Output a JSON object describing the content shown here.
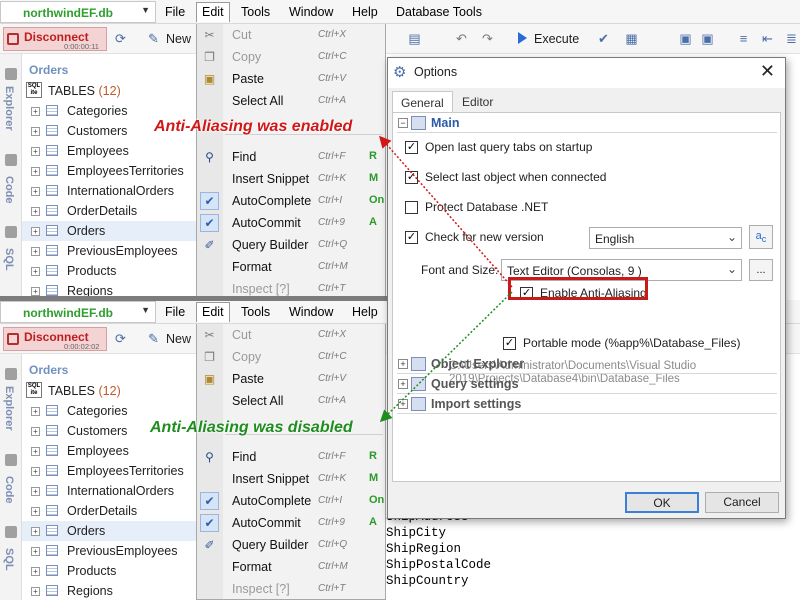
{
  "db_name": "northwindEF.db",
  "menu": [
    "File",
    "Edit",
    "Tools",
    "Window",
    "Help",
    "Database Tools"
  ],
  "toolbar": {
    "disconnect": "Disconnect",
    "time_top": "0:00:00:11",
    "time_bottom": "0:00:02:02",
    "new": "New",
    "execute": "Execute"
  },
  "rail": {
    "explorer": "Explorer",
    "code": "Code",
    "sql": "SQL"
  },
  "explorer": {
    "title": "Orders",
    "tables_label": "TABLES",
    "tables_count": "(12)",
    "items": [
      "Categories",
      "Customers",
      "Employees",
      "EmployeesTerritories",
      "InternationalOrders",
      "OrderDetails",
      "Orders",
      "PreviousEmployees",
      "Products",
      "Regions"
    ]
  },
  "edit_menu": [
    {
      "label": "Cut",
      "shortcut": "Ctrl+X",
      "disabled": true
    },
    {
      "label": "Copy",
      "shortcut": "Ctrl+C",
      "disabled": true
    },
    {
      "label": "Paste",
      "shortcut": "Ctrl+V"
    },
    {
      "label": "Select All",
      "shortcut": "Ctrl+A"
    },
    {
      "label": "Find",
      "shortcut": "Ctrl+F",
      "badge": "R"
    },
    {
      "label": "Insert Snippet",
      "shortcut": "Ctrl+K",
      "badge": "M"
    },
    {
      "label": "AutoComplete",
      "shortcut": "Ctrl+I",
      "badge": "On",
      "checked": true
    },
    {
      "label": "AutoCommit",
      "shortcut": "Ctrl+9",
      "badge": "A",
      "checked": true
    },
    {
      "label": "Query Builder",
      "shortcut": "Ctrl+Q"
    },
    {
      "label": "Format",
      "shortcut": "Ctrl+M"
    },
    {
      "label": "Inspect [?]",
      "shortcut": "Ctrl+T",
      "disabled": true
    }
  ],
  "code_lines": [
    "ShipAddress",
    "ShipCity",
    "ShipRegion",
    "ShipPostalCode",
    "ShipCountry"
  ],
  "dialog": {
    "title": "Options",
    "tabs": [
      "General",
      "Editor"
    ],
    "section_main": "Main",
    "opt_open_last": "Open last query tabs on startup",
    "opt_select_last": "Select last object when connected",
    "opt_protect": "Protect Database .NET",
    "opt_check_version": "Check for new version",
    "language": "English",
    "font_size_label": "Font and Size:",
    "font_value": "Text Editor (Consolas, 9 )",
    "opt_anti_alias": "Enable Anti-Aliasing",
    "path_line1": "C:\\Users\\Administrator\\Documents\\Visual Studio",
    "path_line2": "2019\\Projects\\Database4\\bin\\Database_Files",
    "opt_portable": "Portable mode (%app%\\Database_Files)",
    "section_object_explorer": "Object Explorer",
    "section_query": "Query settings",
    "section_import": "Import settings",
    "ok": "OK",
    "cancel": "Cancel",
    "ellipsis": "..."
  },
  "annotations": {
    "enabled": "Anti-Aliasing was enabled",
    "disabled": "Anti-Aliasing was disabled"
  },
  "colors": {
    "enabled": "#d11818",
    "disabled": "#1f8d1f",
    "highlight_box": "#c91a1a"
  }
}
